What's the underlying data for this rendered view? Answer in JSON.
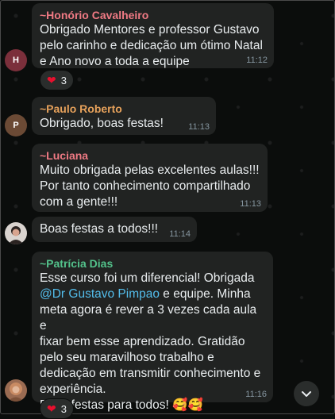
{
  "messages": [
    {
      "sender": "~Honório Cavalheiro",
      "sender_color": "#f07a84",
      "text": "Obrigado Mentores e professor Gustavo\npelo carinho e dedicação um ótimo Natal\ne Ano novo a toda a equipe",
      "time": "11:12",
      "avatar_letter": "H",
      "avatar_color": "#7b2f3b",
      "reaction": {
        "emoji": "heart",
        "count": "3"
      }
    },
    {
      "sender": "~Paulo Roberto",
      "sender_color": "#e6a15b",
      "text": "Obrigado, boas festas!",
      "time": "11:13",
      "avatar_letter": "P",
      "avatar_color": "#6b4a35"
    },
    {
      "sender": "~Luciana",
      "sender_color": "#f07a84",
      "text": "Muito obrigada pelas excelentes aulas!!!\nPor tanto conhecimento compartilhado\ncom a gente!!!",
      "time": "11:13"
    },
    {
      "text": "Boas festas a todos!!!",
      "time": "11:14",
      "avatar_color": "#d9d3cf"
    },
    {
      "sender": "~Patrícia Dias",
      "sender_color": "#53c28b",
      "text_part1": "Esse curso foi um diferencial! Obrigada",
      "mention": "@Dr Gustavo Pimpao",
      "text_part2": " e equipe. Minha\nmeta agora é rever a 3 vezes cada aula e\nfixar bem esse aprendizado. Gratidão\npelo seu maravilhoso trabalho e\ndedicação em transmitir conhecimento e\nexperiência.\nBoas festas para todos! 🥰🥰",
      "time": "11:16",
      "avatar_color": "#9a6b52",
      "reaction": {
        "emoji": "heart",
        "count": "3"
      }
    }
  ],
  "colors": {
    "background": "#0b0d0c",
    "bubble": "#212322",
    "time": "#8696a0",
    "mention": "#53bdeb",
    "heart": "#e8102e"
  },
  "icons": {
    "scroll_down": "chevron-down-icon",
    "reaction": "heart-icon"
  }
}
